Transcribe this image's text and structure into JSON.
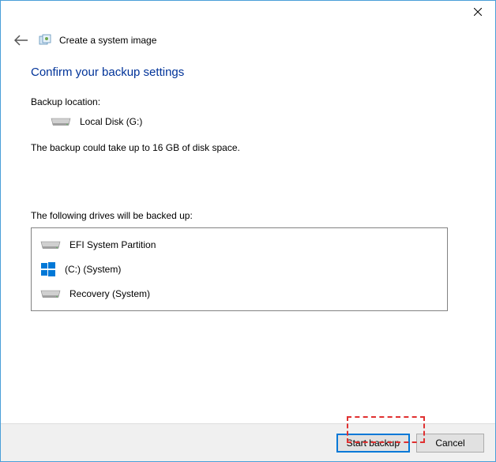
{
  "window": {
    "wizard_title": "Create a system image"
  },
  "main": {
    "heading": "Confirm your backup settings",
    "backup_location_label": "Backup location:",
    "backup_location_value": "Local Disk (G:)",
    "size_estimate": "The backup could take up to 16 GB of disk space.",
    "drives_label": "The following drives will be backed up:",
    "drives": [
      {
        "label": "EFI System Partition",
        "icon": "drive"
      },
      {
        "label": "(C:) (System)",
        "icon": "windows"
      },
      {
        "label": "Recovery (System)",
        "icon": "drive"
      }
    ]
  },
  "footer": {
    "start_label": "Start backup",
    "cancel_label": "Cancel"
  }
}
